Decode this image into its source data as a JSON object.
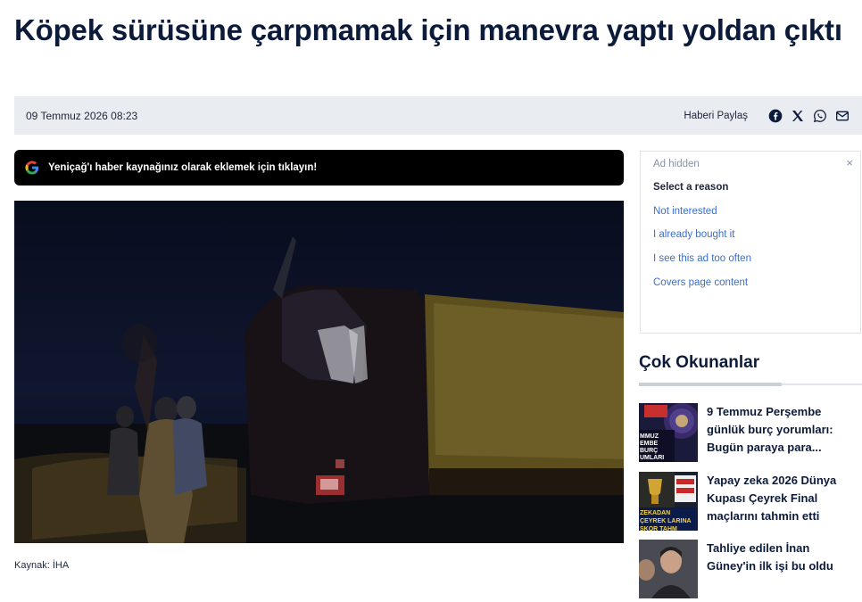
{
  "article": {
    "title": "Köpek sürüsüne çarpmamak için manevra yaptı yoldan çıktı",
    "date": "09 Temmuz 2026 08:23",
    "source_label": "Kaynak:",
    "source_value": "İHA"
  },
  "share": {
    "label": "Haberi Paylaş",
    "icons": [
      "facebook-icon",
      "x-icon",
      "whatsapp-icon",
      "mail-icon"
    ]
  },
  "google_banner": {
    "text": "Yeniçağ'ı haber kaynağınız olarak eklemek için tıklayın!",
    "icon": "google-icon"
  },
  "ad": {
    "hidden_label": "Ad hidden",
    "close_glyph": "×",
    "reason_title": "Select a reason",
    "options": [
      "Not interested",
      "I already bought it",
      "I see this ad too often",
      "Covers page content"
    ]
  },
  "most_read": {
    "title": "Çok Okunanlar",
    "items": [
      {
        "title": "9 Temmuz Perşembe günlük burç yorumları: Bugün paraya para...",
        "thumb_text": "MMUZ EMBE BURÇ UMLARI"
      },
      {
        "title": "Yapay zeka 2026 Dünya Kupası Çeyrek Final maçlarını tahmin etti",
        "thumb_text": "ZEKADAN ÇEYREK LARINA SKOR TAHM"
      },
      {
        "title": "Tahliye edilen İnan Güney'in ilk işi bu oldu",
        "thumb_text": ""
      }
    ]
  },
  "colors": {
    "headline": "#0d1b3a",
    "meta_bar": "#e9ecf1",
    "ad_link": "#3b6fc9",
    "banner": "#000000"
  }
}
